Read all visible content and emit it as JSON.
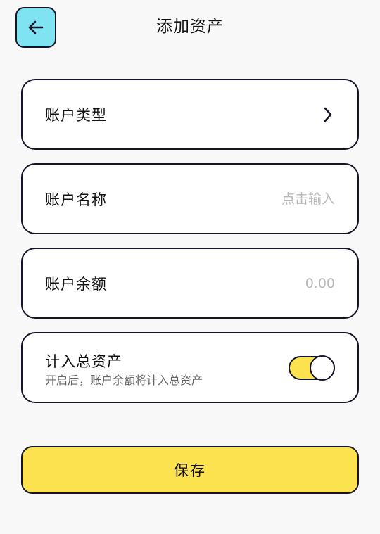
{
  "header": {
    "back_icon": "arrow-left-icon",
    "title": "添加资产"
  },
  "form": {
    "account_type": {
      "label": "账户类型",
      "icon": "chevron-right-icon"
    },
    "account_name": {
      "label": "账户名称",
      "value": "",
      "placeholder": "点击输入"
    },
    "account_balance": {
      "label": "账户余额",
      "value": "",
      "placeholder": "0.00"
    },
    "include_total": {
      "label": "计入总资产",
      "description": "开启后，账户余额将计入总资产",
      "enabled": true
    }
  },
  "actions": {
    "save_label": "保存"
  },
  "colors": {
    "accent_yellow": "#fde24f",
    "back_button": "#7fe3f2",
    "border": "#15152a",
    "background": "#f8f8f8",
    "placeholder": "#b9b9b9"
  }
}
